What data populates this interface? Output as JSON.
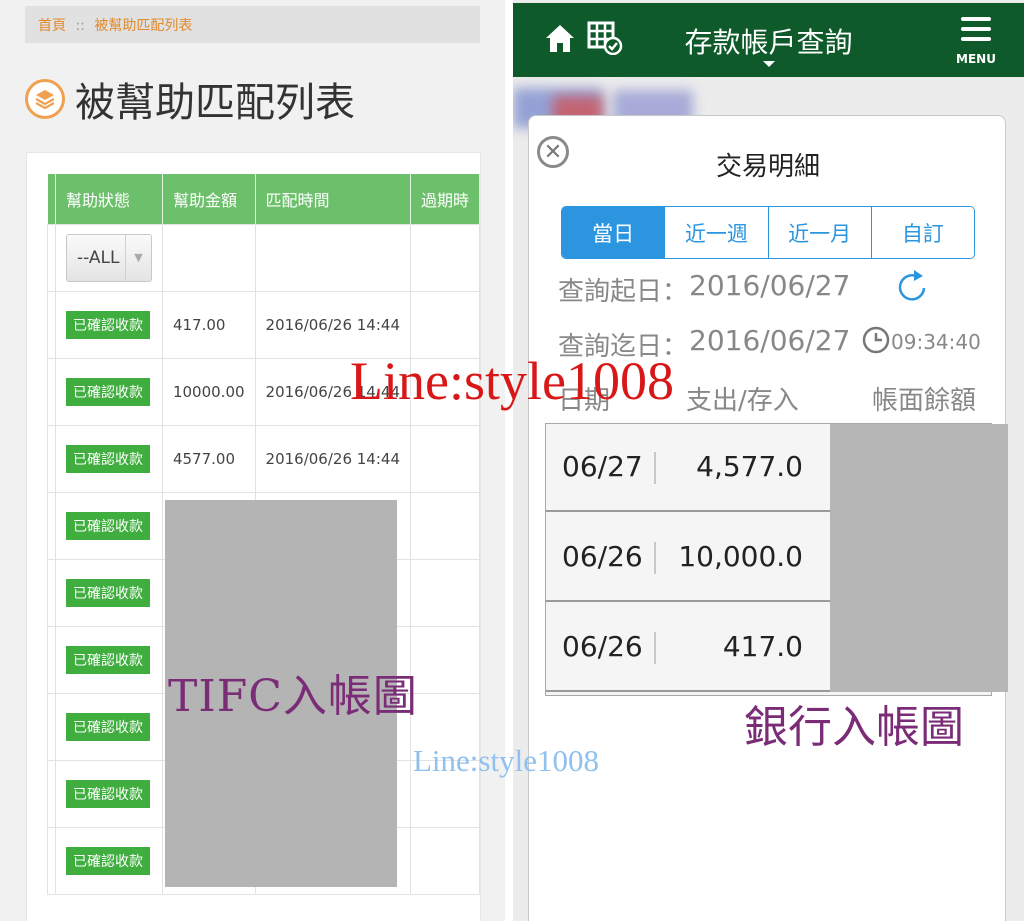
{
  "left_panel": {
    "breadcrumb": {
      "home": "首頁",
      "separator": "::",
      "current": "被幫助匹配列表"
    },
    "title": "被幫助匹配列表",
    "columns": [
      "幫助狀態",
      "幫助金額",
      "匹配時間",
      "過期時"
    ],
    "filter": {
      "selected": "--ALL"
    },
    "rows": [
      {
        "status": "已確認收款",
        "amount": "417.00",
        "time": "2016/06/26 14:44"
      },
      {
        "status": "已確認收款",
        "amount": "10000.00",
        "time": "2016/06/26 14:44"
      },
      {
        "status": "已確認收款",
        "amount": "4577.00",
        "time": "2016/06/26 14:44"
      },
      {
        "status": "已確認收款",
        "amount": "",
        "time": ""
      },
      {
        "status": "已確認收款",
        "amount": "",
        "time": ""
      },
      {
        "status": "已確認收款",
        "amount": "",
        "time": ""
      },
      {
        "status": "已確認收款",
        "amount": "",
        "time": ""
      },
      {
        "status": "已確認收款",
        "amount": "",
        "time": ""
      },
      {
        "status": "已確認收款",
        "amount": "",
        "time": ""
      }
    ],
    "overlay_label": "TIFC入帳圖"
  },
  "right_panel": {
    "app_bar": {
      "title": "存款帳戶查詢",
      "home_icon": "home-icon",
      "account_icon": "account-table-icon",
      "menu_label": "MENU"
    },
    "modal": {
      "title": "交易明細",
      "tabs": [
        {
          "label": "當日",
          "active": true
        },
        {
          "label": "近一週",
          "active": false
        },
        {
          "label": "近一月",
          "active": false
        },
        {
          "label": "自訂",
          "active": false
        }
      ],
      "start_label": "查詢起日：",
      "start_date": "2016/06/27",
      "end_label": "查詢迄日：",
      "end_date": "2016/06/27",
      "query_time": "09:34:40",
      "headers": {
        "date": "日期",
        "amount": "支出/存入",
        "balance": "帳面餘額"
      },
      "transactions": [
        {
          "date": "06/27",
          "amount": "4,577.0"
        },
        {
          "date": "06/26",
          "amount": "10,000.0"
        },
        {
          "date": "06/26",
          "amount": "417.0"
        }
      ]
    },
    "overlay_label": "銀行入帳圖"
  },
  "watermarks": {
    "large": "Line:style1008",
    "small": "Line:style1008"
  },
  "colors": {
    "table_header_green": "#6cc06c",
    "status_badge_green": "#3fae3f",
    "app_bar_green": "#0e5a2a",
    "tab_blue": "#2b95e0",
    "overlay_purple": "#7a2c76",
    "watermark_red": "#d81818",
    "watermark_light_blue": "#8fc0ee"
  }
}
